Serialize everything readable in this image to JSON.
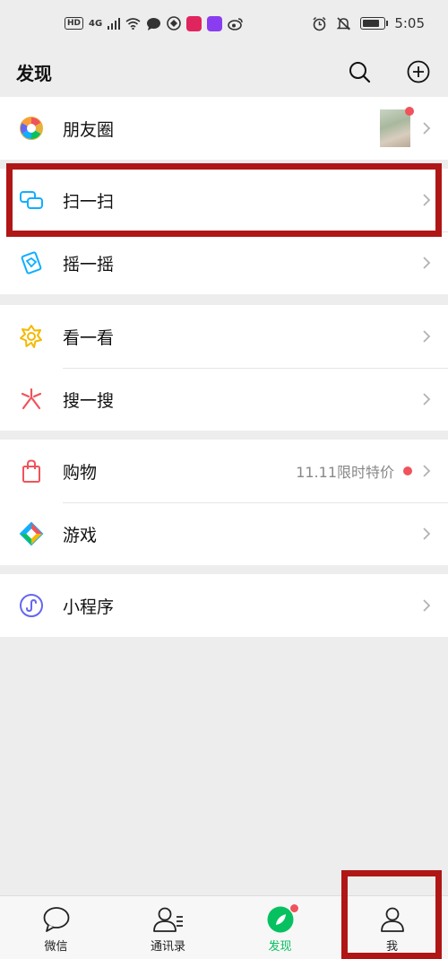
{
  "status_bar": {
    "network": "4G",
    "time": "5:05",
    "hd": "HD"
  },
  "header": {
    "title": "发现"
  },
  "groups": [
    {
      "items": [
        {
          "label": "朋友圈",
          "icon": "moments-icon"
        }
      ]
    },
    {
      "items": [
        {
          "label": "扫一扫",
          "icon": "scan-icon"
        },
        {
          "label": "摇一摇",
          "icon": "shake-icon"
        }
      ]
    },
    {
      "items": [
        {
          "label": "看一看",
          "icon": "top-stories-icon"
        },
        {
          "label": "搜一搜",
          "icon": "search-search-icon"
        }
      ]
    },
    {
      "items": [
        {
          "label": "购物",
          "icon": "shopping-bag-icon",
          "extra": "11.11限时特价"
        },
        {
          "label": "游戏",
          "icon": "games-icon"
        }
      ]
    },
    {
      "items": [
        {
          "label": "小程序",
          "icon": "mini-programs-icon"
        }
      ]
    }
  ],
  "tabbar": {
    "tabs": [
      {
        "label": "微信",
        "icon": "chat-bubble-icon"
      },
      {
        "label": "通讯录",
        "icon": "contacts-icon"
      },
      {
        "label": "发现",
        "icon": "discover-compass-icon",
        "active": true
      },
      {
        "label": "我",
        "icon": "me-person-icon"
      }
    ]
  },
  "colors": {
    "accent": "#07c160",
    "badge": "#f0535b",
    "highlight": "#b01616"
  }
}
